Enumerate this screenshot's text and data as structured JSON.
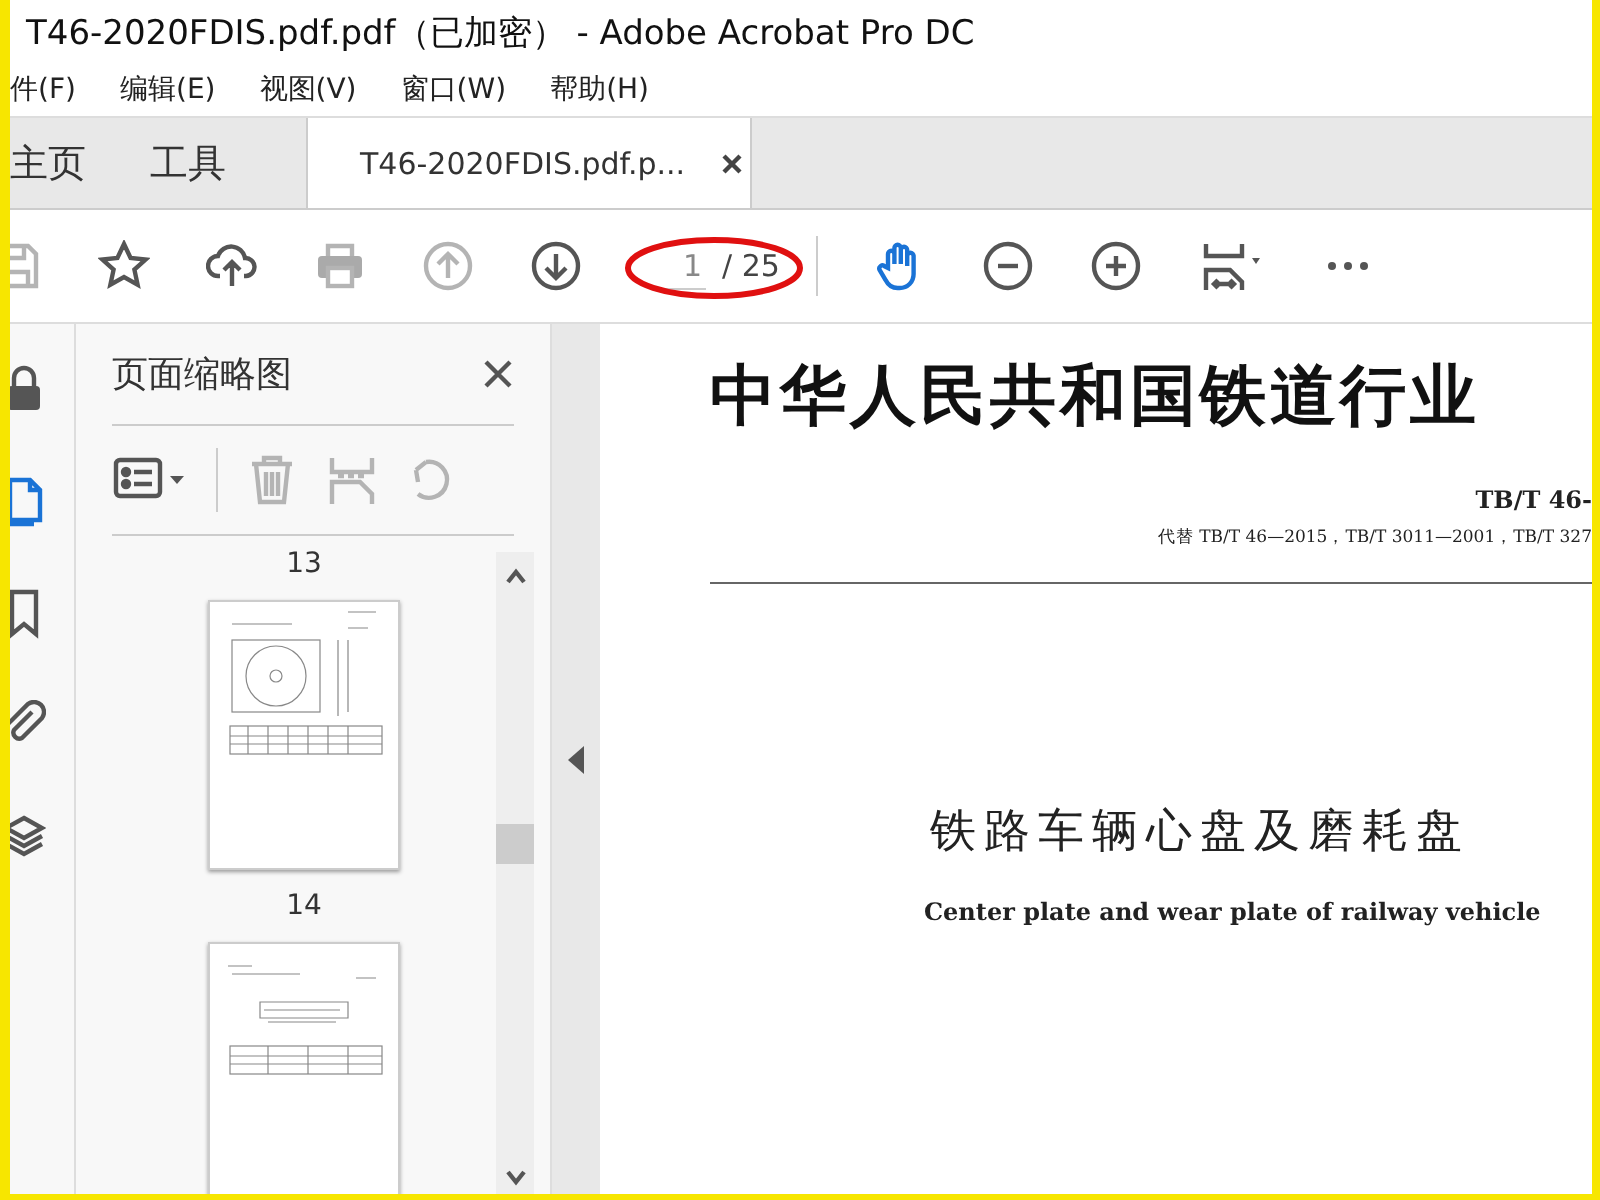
{
  "window": {
    "title": "T46-2020FDIS.pdf.pdf（已加密） - Adobe Acrobat Pro DC"
  },
  "menu": [
    "件(F)",
    "编辑(E)",
    "视图(V)",
    "窗口(W)",
    "帮助(H)"
  ],
  "tabs": [
    {
      "label": "主页",
      "selected": false,
      "closable": false
    },
    {
      "label": "工具",
      "selected": false,
      "closable": false
    },
    {
      "label": "T46-2020FDIS.pdf.p...",
      "selected": true,
      "closable": true
    }
  ],
  "toolbar": {
    "tools": [
      {
        "kind": "save",
        "disabled": true
      },
      {
        "kind": "star",
        "disabled": false
      },
      {
        "kind": "upload",
        "disabled": false
      },
      {
        "kind": "print",
        "disabled": true
      },
      {
        "kind": "prev",
        "disabled": true
      },
      {
        "kind": "next",
        "disabled": false
      },
      {
        "kind": "page",
        "value": "1",
        "total": "/ 25",
        "highlighted": true
      },
      {
        "kind": "separator"
      },
      {
        "kind": "hand",
        "selected": true
      },
      {
        "kind": "zoomout",
        "disabled": false
      },
      {
        "kind": "zoomin",
        "disabled": false
      },
      {
        "kind": "fit",
        "disabled": false
      },
      {
        "kind": "more",
        "disabled": false
      }
    ]
  },
  "rail": [
    {
      "kind": "lock",
      "selected": false
    },
    {
      "kind": "pages",
      "selected": true
    },
    {
      "kind": "bookmark",
      "selected": false
    },
    {
      "kind": "clip",
      "selected": false
    },
    {
      "kind": "layers",
      "selected": false
    }
  ],
  "thumbnail_panel": {
    "title": "页面缩略图",
    "tools": [
      {
        "kind": "options",
        "disabled": false
      },
      {
        "kind": "separator"
      },
      {
        "kind": "delete",
        "disabled": true
      },
      {
        "kind": "extract",
        "disabled": true
      },
      {
        "kind": "rotate",
        "disabled": true
      }
    ],
    "items": [
      {
        "kind": "label",
        "text": "13"
      },
      {
        "kind": "page"
      },
      {
        "kind": "label",
        "text": "14"
      },
      {
        "kind": "page"
      }
    ]
  },
  "document": {
    "heading": "中华人民共和国铁道行业",
    "code": "TB/T 46-",
    "replaces": "代替 TB/T 46—2015，TB/T 3011—2001，TB/T 327",
    "title_zh": "铁路车辆心盘及磨耗盘",
    "title_en": "Center plate and wear plate of railway vehicle"
  }
}
